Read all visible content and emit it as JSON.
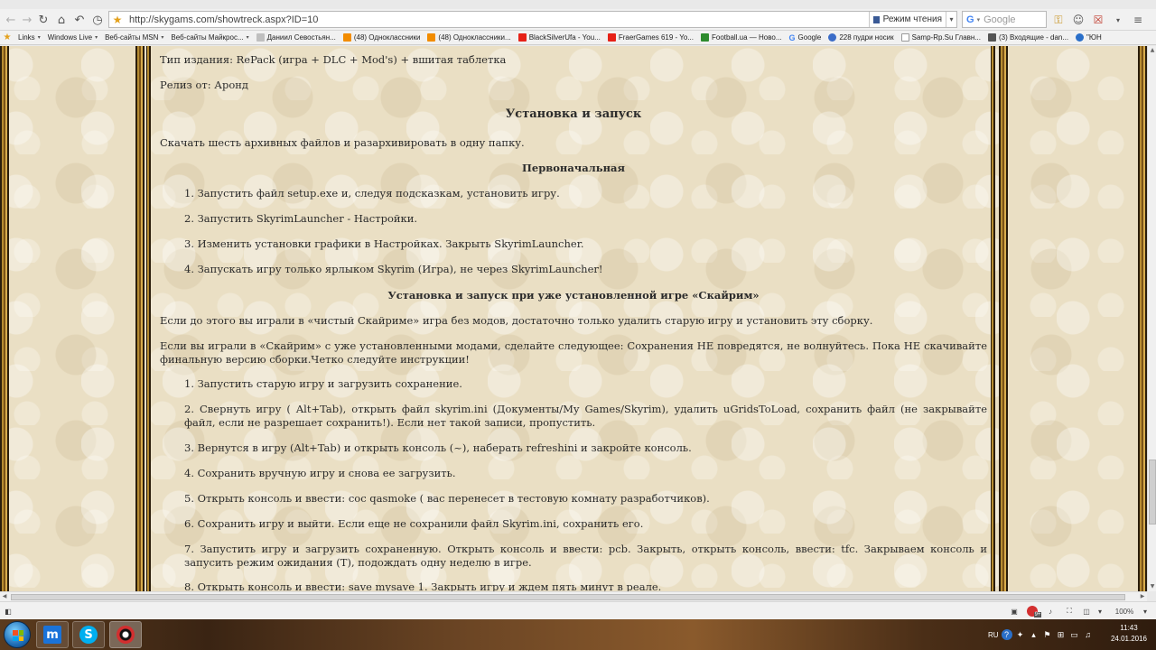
{
  "nav": {
    "url": "http://skygams.com/showtreck.aspx?ID=10",
    "reader_label": "Режим чтения",
    "search_placeholder": "Google"
  },
  "bookmarks": [
    {
      "label": "Links",
      "color": "#ffffff",
      "dropdown": true
    },
    {
      "label": "Windows Live",
      "color": "#ffffff",
      "dropdown": true
    },
    {
      "label": "Веб-сайты MSN",
      "color": "#ffffff",
      "dropdown": true
    },
    {
      "label": "Веб-сайты Майкрос...",
      "color": "#ffffff",
      "dropdown": true
    },
    {
      "label": "Даниил Севостьян...",
      "color": "#bfbfbf",
      "dropdown": false
    },
    {
      "label": "(48) Одноклассники",
      "color": "#f28c00",
      "dropdown": false
    },
    {
      "label": "(48) Одноклассники...",
      "color": "#f28c00",
      "dropdown": false
    },
    {
      "label": "BlackSilverUfa - You...",
      "color": "#e62117",
      "dropdown": false
    },
    {
      "label": "FraerGames 619 - Yo...",
      "color": "#e62117",
      "dropdown": false
    },
    {
      "label": "Football.ua — Ново...",
      "color": "#2e8b2e",
      "dropdown": false
    },
    {
      "label": "Google",
      "color": "#4285f4",
      "dropdown": false
    },
    {
      "label": "228 пудри носик",
      "color": "#3b6cc8",
      "dropdown": false
    },
    {
      "label": "Samp-Rp.Su Главн...",
      "color": "#ffffff",
      "dropdown": false
    },
    {
      "label": "(3) Входящие - dan...",
      "color": "#555555",
      "dropdown": false
    },
    {
      "label": "\"ЮН",
      "color": "#2a6fc9",
      "dropdown": false
    }
  ],
  "article": {
    "edition_type": "Тип издания: RePack (игра + DLC + Mod's) + вшитая таблетка",
    "release": "Релиз от: Аронд",
    "h_install": "Установка и запуск",
    "download": "Скачать шесть архивных файлов и разархивировать в одну папку.",
    "h_initial": "Первоначальная",
    "initial_steps": [
      "1. Запустить файл setup.exe и, следуя подсказкам, установить игру.",
      "2. Запустить  SkyrimLauncher - Настройки.",
      "3. Изменить установки графики в Настройках. Закрыть SkyrimLauncher.",
      "4. Запускать игру только  ярлыком Skyrim (Игра), не через SkyrimLauncher!"
    ],
    "h_installed": "Установка и запуск при уже установленной игре «Скайрим»",
    "para_clean": " Если до этого вы играли в «чистый Скайриме» игра без модов, достаточно только удалить старую игру и установить  эту сборку.",
    "para_mods": " Если вы играли в «Скайрим» с уже установленными модами, сделайте следующее: Сохранения НЕ повредятся, не волнуйтесь. Пока НЕ скачивайте финальную версию сборки.Четко следуйте инструкции!",
    "mod_steps": [
      "1. Запустить  старую игру и загрузить сохранение.",
      "2. Свернуть игру ( Alt+Tab), открыть файл skyrim.ini (Документы/My Games/Skyrim), удалить uGridsToLoad, сохранить файл (не закрывайте файл, если не разрешает сохранить!). Если нет такой записи, пропустить.",
      "3. Вернутся в игру (Alt+Tab) и открыть консоль (~),  наберать refreshini и закройте консоль.",
      "4. Сохранить вручную игру  и снова ее загрузить.",
      "5. Открыть консоль и ввести: coc qasmoke ( вас перенесет в тестовую комнату разработчиков).",
      "6. Сохранить игру и выйти. Если еще не сохранили файл Skyrim.ini, сохранить его.",
      "7. Запустить игру и загрузить сохраненную. Открыть консоль и ввести: pcb. Закрыть, открыть консоль, ввести: tfc. Закрываем консоль и запусить режим ожидания (Т), подождать одну неделю в игре.",
      "8. Открыть консоль и ввести: save mysave 1. Закрыть игру и ждем пять минут в реале."
    ]
  },
  "status": {
    "zoom": "100%",
    "adblock_count": "9+"
  },
  "tray": {
    "lang": "RU",
    "time": "11:43",
    "date": "24.01.2016"
  }
}
